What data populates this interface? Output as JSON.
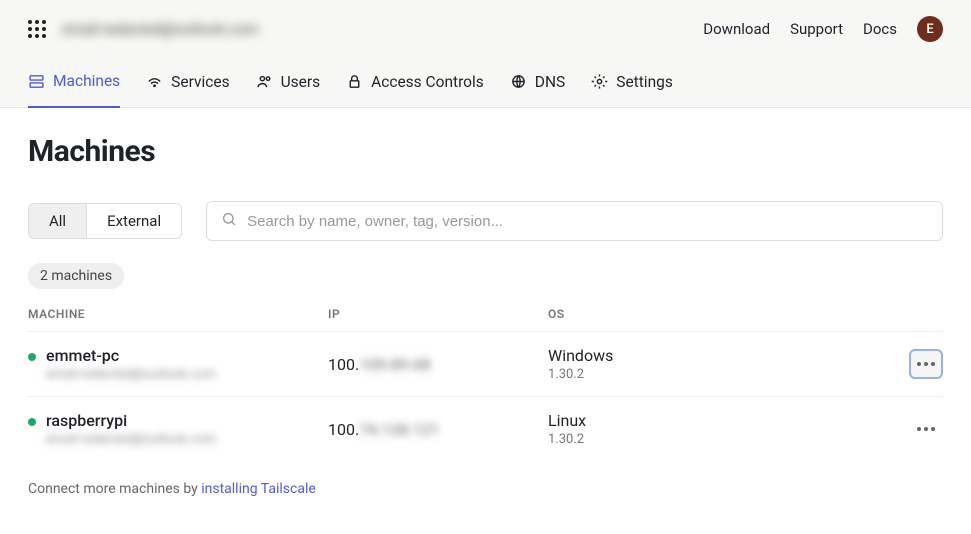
{
  "header": {
    "account_email_redacted": "email-redacted@outlook.com",
    "links": {
      "download": "Download",
      "support": "Support",
      "docs": "Docs"
    },
    "avatar_initial": "E"
  },
  "nav": {
    "machines": "Machines",
    "services": "Services",
    "users": "Users",
    "access_controls": "Access Controls",
    "dns": "DNS",
    "settings": "Settings"
  },
  "page": {
    "title": "Machines",
    "filter_all": "All",
    "filter_external": "External",
    "search_placeholder": "Search by name, owner, tag, version...",
    "machine_count_badge": "2 machines"
  },
  "table": {
    "headers": {
      "machine": "MACHINE",
      "ip": "IP",
      "os": "OS"
    },
    "rows": [
      {
        "name": "emmet-pc",
        "owner_redacted": "email-redacted@outlook.com",
        "ip_prefix": "100.",
        "ip_rest_redacted": "109.89.68",
        "os": "Windows",
        "version": "1.30.2",
        "status_color": "#1fa865",
        "more_focused": true
      },
      {
        "name": "raspberrypi",
        "owner_redacted": "email-redacted@outlook.com",
        "ip_prefix": "100.",
        "ip_rest_redacted": "74.128.121",
        "os": "Linux",
        "version": "1.30.2",
        "status_color": "#1fa865",
        "more_focused": false
      }
    ]
  },
  "footer": {
    "text": "Connect more machines by ",
    "link": "installing Tailscale"
  }
}
